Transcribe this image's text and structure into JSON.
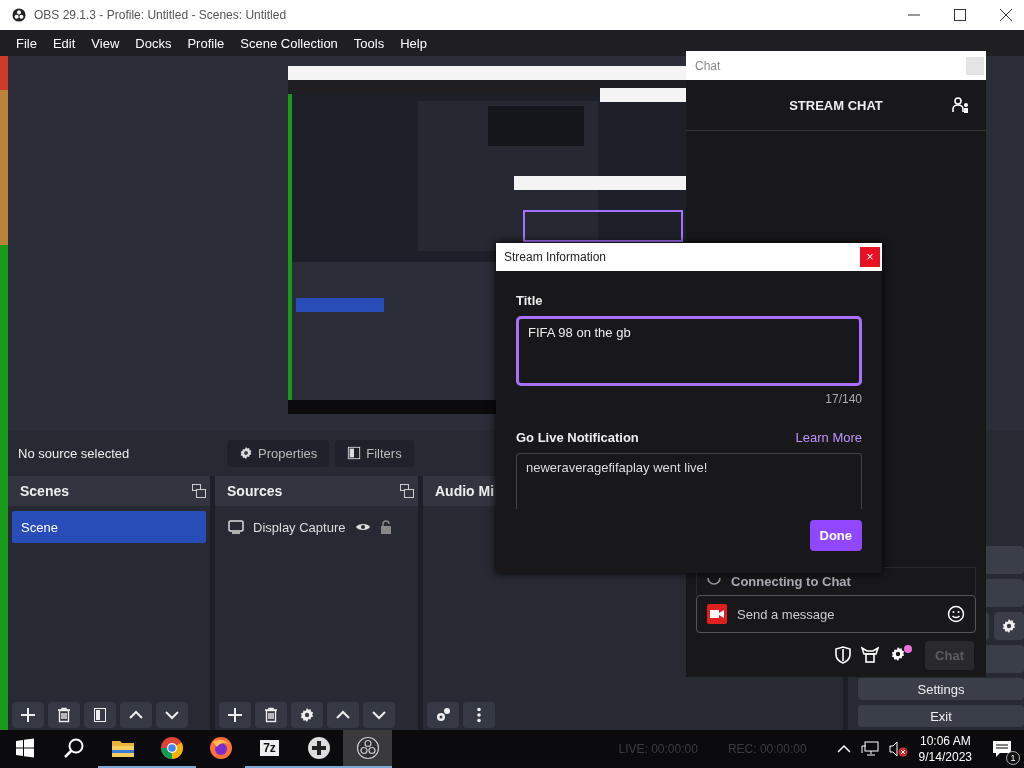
{
  "window": {
    "title": "OBS 29.1.3 - Profile: Untitled - Scenes: Untitled"
  },
  "menu": [
    "File",
    "Edit",
    "View",
    "Docks",
    "Profile",
    "Scene Collection",
    "Tools",
    "Help"
  ],
  "preview": {
    "kind": "picture"
  },
  "source_bar": {
    "status": "No source selected",
    "buttons": [
      {
        "label": "Properties",
        "kind": "gear"
      },
      {
        "label": "Filters",
        "kind": "filter"
      }
    ]
  },
  "docks": [
    {
      "title": "Scenes",
      "items": [
        {
          "label": "Scene",
          "selected": true
        }
      ]
    },
    {
      "title": "Sources",
      "items": [
        {
          "label": "Display Capture",
          "selected": false,
          "visible": true,
          "locked": false
        }
      ]
    },
    {
      "title": "Audio Mi"
    }
  ],
  "controls": [
    "Settings",
    "Exit"
  ],
  "status_bar": {
    "live": "LIVE: 00:00:00",
    "rec": "REC: 00:00:00"
  },
  "chat": {
    "window_title": "Chat",
    "header": "STREAM CHAT",
    "connection": "Connecting to Chat",
    "placeholder": "Send a message",
    "send_button": {
      "label": "Chat",
      "disabled": true
    }
  },
  "dialog": {
    "title": "Stream Information",
    "close": "×",
    "title_label": "Title",
    "title_value": "FIFA 98 on the gb",
    "counter": "17/140",
    "notification_label": "Go Live Notification",
    "learn_more": "Learn More",
    "notification_value": "neweraveragefifaplay went live!",
    "done": "Done"
  },
  "taskbar": {
    "apps": [
      {
        "kind": "start",
        "running": false,
        "active": false
      },
      {
        "kind": "search",
        "running": false,
        "active": false
      },
      {
        "kind": "folder",
        "running": true,
        "active": false
      },
      {
        "kind": "chrome",
        "running": true,
        "active": false
      },
      {
        "kind": "firefox",
        "running": false,
        "active": false
      },
      {
        "kind": "zip",
        "label": "7z",
        "running": true,
        "active": false
      },
      {
        "kind": "gamepad",
        "running": true,
        "active": false
      },
      {
        "kind": "obs",
        "running": true,
        "active": true
      }
    ],
    "time": "10:06 AM",
    "date": "9/14/2023",
    "notifications": "1"
  }
}
